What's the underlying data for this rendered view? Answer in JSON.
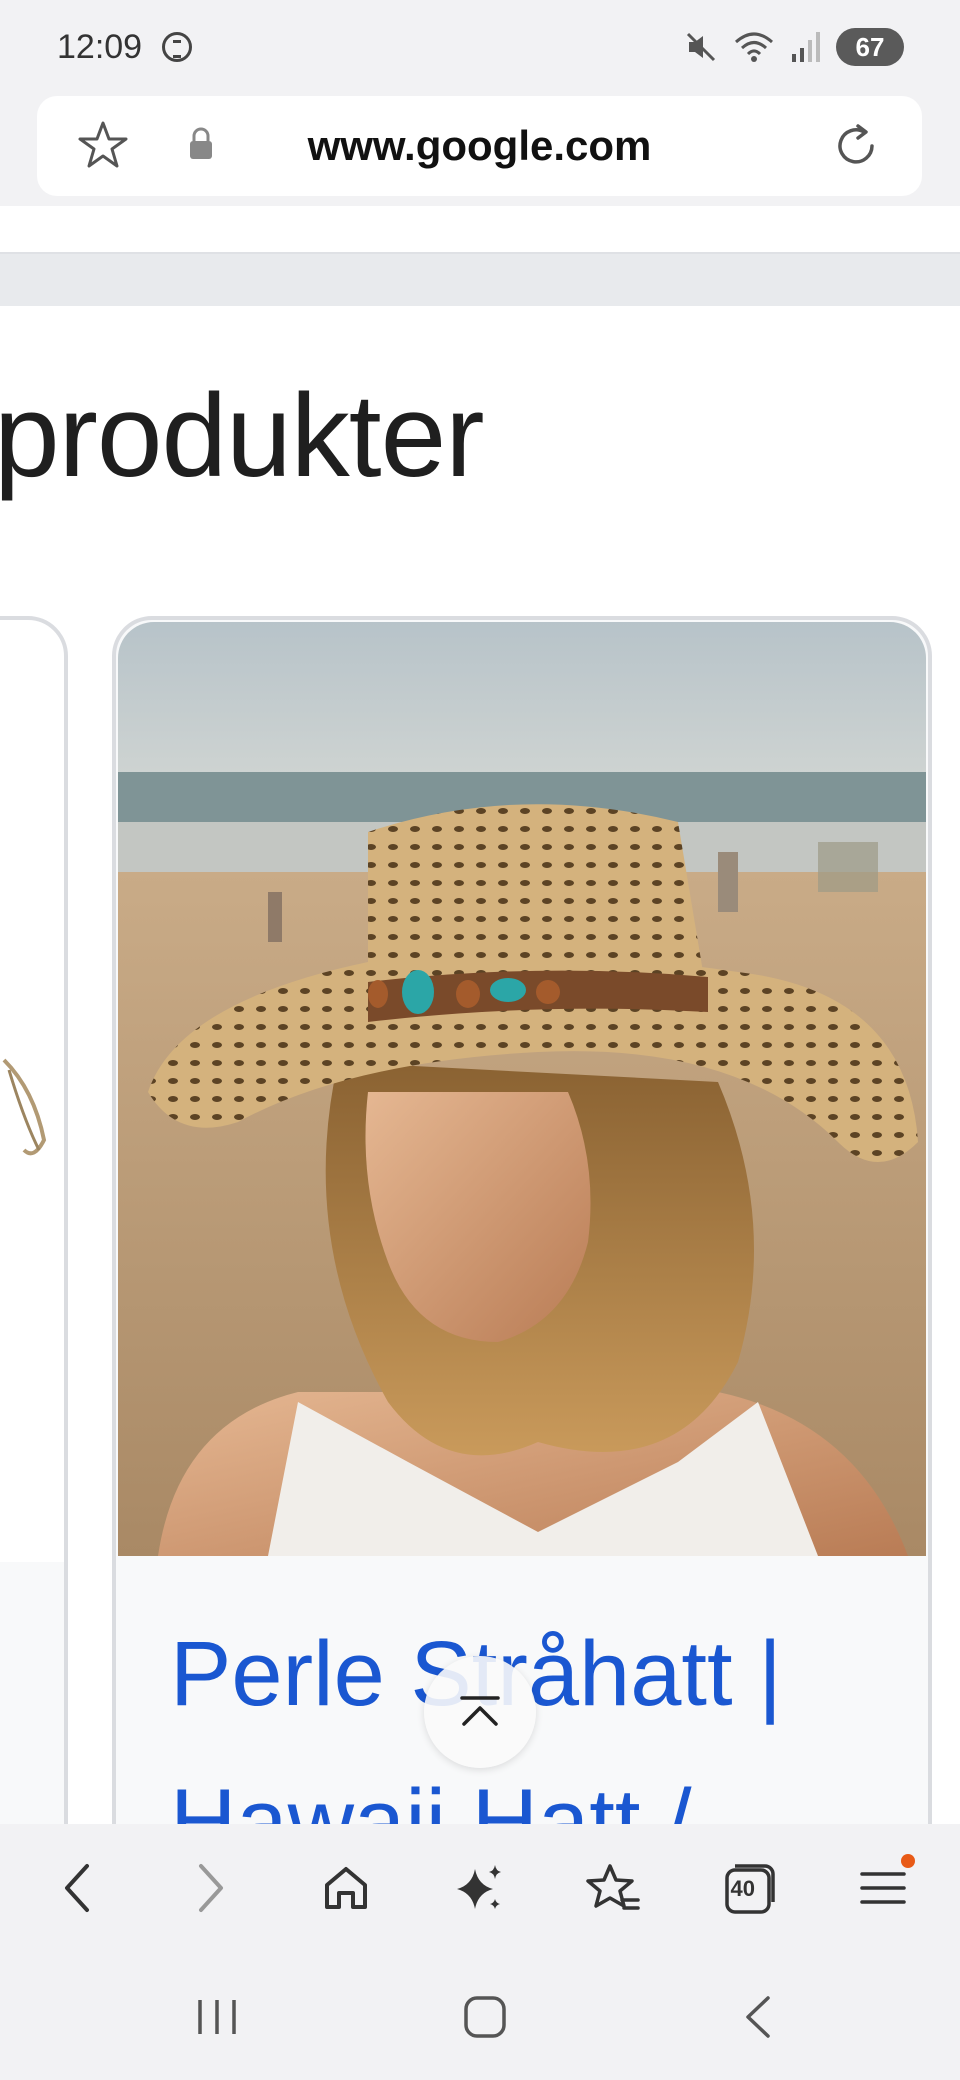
{
  "status_bar": {
    "time": "12:09",
    "battery": "67",
    "icons": [
      "hourglass-icon",
      "mute-icon",
      "wifi-icon",
      "signal-icon",
      "battery-icon"
    ]
  },
  "browser": {
    "url": "www.google.com",
    "icons": [
      "star-icon",
      "lock-icon",
      "reload-icon"
    ]
  },
  "page": {
    "heading": "produkter",
    "product_card": {
      "title": "Perle Stråhatt | Hawaii Hatt /",
      "image": "woman-in-straw-hat-on-beach"
    }
  },
  "toolbar": {
    "tabs_count": "40",
    "buttons": [
      "back",
      "forward",
      "home",
      "ai-sparkle",
      "bookmarks",
      "tabs",
      "menu"
    ]
  },
  "colors": {
    "link_blue": "#1a57d1",
    "notification_dot": "#e85a16",
    "chrome_bg": "#f2f2f4"
  }
}
